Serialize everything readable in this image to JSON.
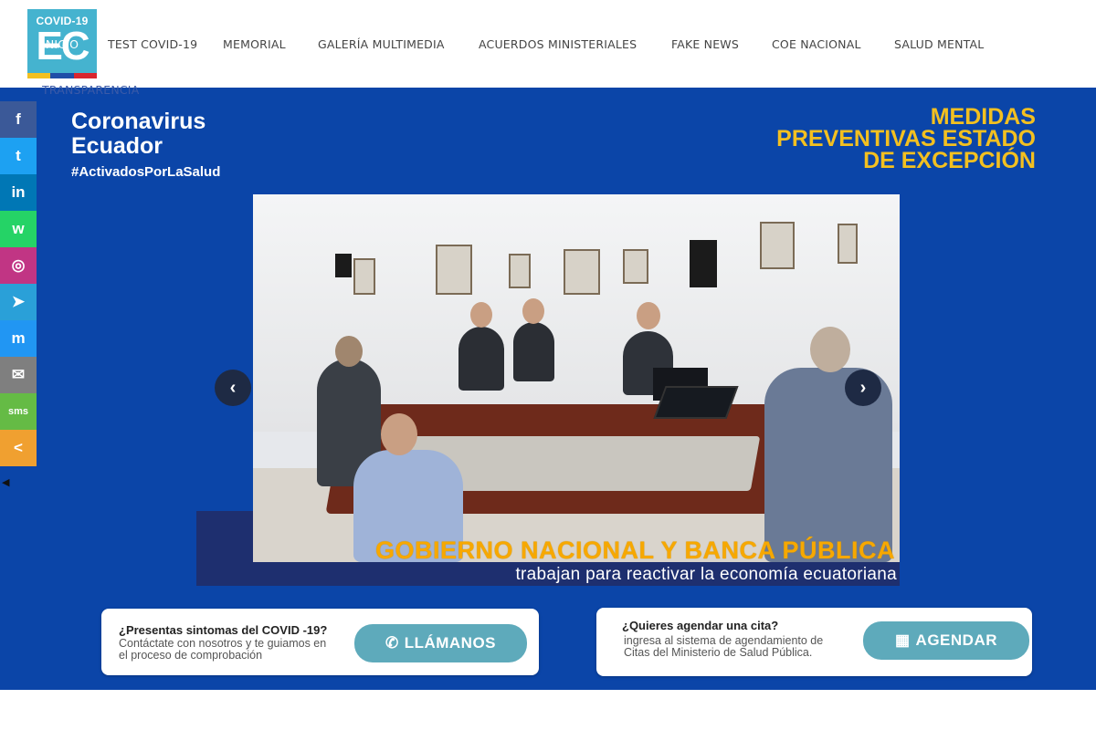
{
  "logo": {
    "top": "COVID-19",
    "big": "EC",
    "bar_colors": [
      "#f3c020",
      "#1f4ea8",
      "#d9262e"
    ]
  },
  "nav": {
    "items": [
      "INICIO",
      "TEST COVID-19",
      "MEMORIAL",
      "GALERÍA MULTIMEDIA",
      "ACUERDOS MINISTERIALES",
      "FAKE NEWS",
      "COE NACIONAL",
      "SALUD MENTAL",
      "TRANSPARENCIA"
    ]
  },
  "hero": {
    "brand_line1": "Coronavirus",
    "brand_line2": "Ecuador",
    "hashtag": "#ActivadosPorLaSalud",
    "medidas_l1": "MEDIDAS",
    "medidas_l2": "PREVENTIVAS ESTADO",
    "medidas_l3": "DE EXCEPCIÓN",
    "caption_title": "GOBIERNO NACIONAL Y BANCA PÚBLICA",
    "caption_sub": "trabajan para reactivar la economía ecuatoriana",
    "prev_icon": "chevron-left-icon",
    "next_icon": "chevron-right-icon",
    "bg_color": "#0b45a8",
    "accent_color": "#f3c020"
  },
  "cards": {
    "left_question": "¿Presentas sintomas del COVID -19?",
    "left_desc_l1": "Contáctate con nosotros y te guiamos en",
    "left_desc_l2": "el proceso de comprobación",
    "left_button": "LLÁMANOS",
    "left_icon": "phone-icon",
    "right_question": "¿Quieres agendar una cita?",
    "right_desc_l1": "ingresa al sistema de agendamiento de",
    "right_desc_l2": "Citas del Ministerio de Salud Pública.",
    "right_button": "AGENDAR",
    "right_icon": "calendar-icon",
    "button_color": "#5eaabb"
  },
  "social": {
    "items": [
      {
        "name": "facebook-icon",
        "glyph": "f",
        "color": "#3b5998"
      },
      {
        "name": "twitter-icon",
        "glyph": "t",
        "color": "#1da1f2"
      },
      {
        "name": "linkedin-icon",
        "glyph": "in",
        "color": "#0077b5"
      },
      {
        "name": "whatsapp-icon",
        "glyph": "w",
        "color": "#25d366"
      },
      {
        "name": "instagram-icon",
        "glyph": "◎",
        "color": "#c13584"
      },
      {
        "name": "telegram-icon",
        "glyph": "➤",
        "color": "#2aa0d8"
      },
      {
        "name": "messenger-icon",
        "glyph": "m",
        "color": "#2196f3"
      },
      {
        "name": "email-icon",
        "glyph": "✉",
        "color": "#7f7f7f"
      },
      {
        "name": "sms-icon",
        "glyph": "sms",
        "color": "#65bb45"
      },
      {
        "name": "share-icon",
        "glyph": "<",
        "color": "#f0a030"
      }
    ],
    "hide_icon": "hide-arrow-icon"
  }
}
